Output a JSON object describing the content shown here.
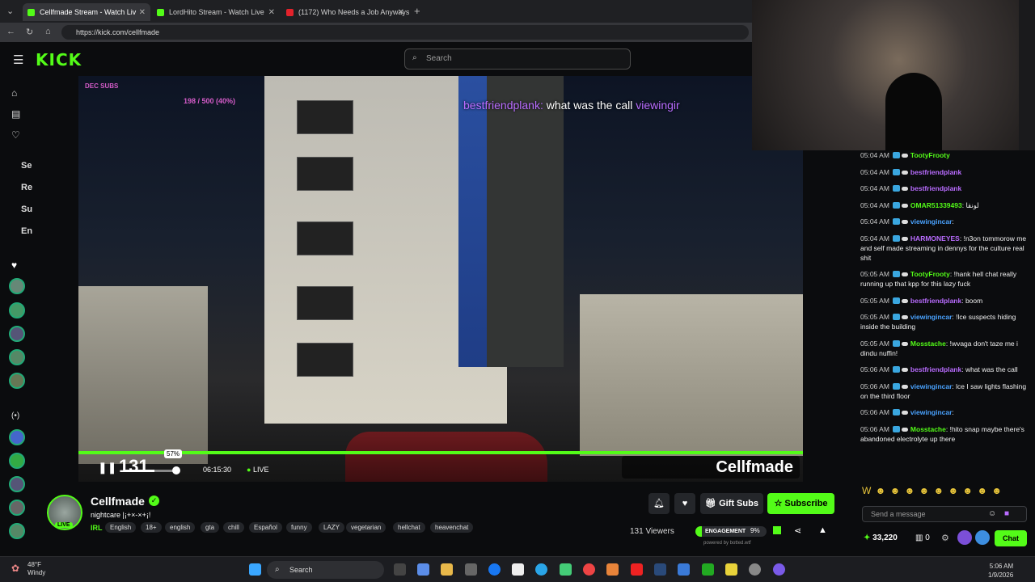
{
  "browser": {
    "tabs": [
      {
        "title": "Cellfmade Stream - Watch Liv",
        "active": true
      },
      {
        "title": "LordHito Stream - Watch Live",
        "active": false
      },
      {
        "title": "(1172) Who Needs a Job Anyways",
        "active": false
      }
    ],
    "new_tab": "+",
    "url": "https://kick.com/cellfmade"
  },
  "header": {
    "logo": "KICK",
    "search_placeholder": "Search"
  },
  "sidebar": {
    "abbr": [
      "Se",
      "Re",
      "Su",
      "En"
    ]
  },
  "video": {
    "dec_subs": "DEC SUBS",
    "sub_goal": "198 / 500 (40%)",
    "overlay_chat_user": "bestfriendplank:",
    "overlay_chat_text": " what was the call ",
    "overlay_chat_next": "viewingir",
    "brand": "Cellfmade",
    "viewer_overlay": "131",
    "volume_tooltip": "57%",
    "volume_level": 0.57,
    "time": "06:15:30",
    "live_label": "LIVE"
  },
  "channel": {
    "name": "Cellfmade",
    "title": "nightcare |¡+×-×+¡!",
    "category": "IRL",
    "live_badge": "LIVE",
    "tags": [
      "English",
      "18+",
      "english",
      "gta",
      "chill",
      "Español",
      "funny",
      "LAZY",
      "vegetarian",
      "hellchat",
      "heavenchat"
    ],
    "gift_label": "Gift Subs",
    "subscribe_label": "Subscribe",
    "viewers": "131 Viewers",
    "engagement_label": "ENGAGEMENT",
    "engagement_pct": "9%",
    "engagement_level": 0.09,
    "powered_by": "powered by botted.wtf"
  },
  "chat": {
    "messages": [
      {
        "time": "05:04 AM",
        "user": "TootyFrooty",
        "color": "#53fc18",
        "text": ""
      },
      {
        "time": "05:04 AM",
        "user": "bestfriendplank",
        "color": "#b96cff",
        "text": ""
      },
      {
        "time": "05:04 AM",
        "user": "bestfriendplank",
        "color": "#b96cff",
        "text": ""
      },
      {
        "time": "05:04 AM",
        "user": "OMAR51339493",
        "color": "#53fc18",
        "text": ": لونقا"
      },
      {
        "time": "05:04 AM",
        "user": "viewingincar",
        "color": "#4aa3ff",
        "text": ":"
      },
      {
        "time": "05:04 AM",
        "user": "HARMONEYES",
        "color": "#b96cff",
        "text": ": !n3on tommorow me and self made streaming in dennys for the culture real shit"
      },
      {
        "time": "05:05 AM",
        "user": "TootyFrooty",
        "color": "#53fc18",
        "text": ": !hank hell chat really running up that kpp for this lazy fuck"
      },
      {
        "time": "05:05 AM",
        "user": "bestfriendplank",
        "color": "#b96cff",
        "text": ": boom"
      },
      {
        "time": "05:05 AM",
        "user": "viewingincar",
        "color": "#4aa3ff",
        "text": ": !lce suspects hiding inside the building"
      },
      {
        "time": "05:05 AM",
        "user": "Mosstache",
        "color": "#53fc18",
        "text": ": !wvaga don't taze me i dindu nuffin!"
      },
      {
        "time": "05:06 AM",
        "user": "bestfriendplank",
        "color": "#b96cff",
        "text": ": what was the call"
      },
      {
        "time": "05:06 AM",
        "user": "viewingincar",
        "color": "#4aa3ff",
        "text": ": lce I saw lights flashing on the third floor"
      },
      {
        "time": "05:06 AM",
        "user": "viewingincar",
        "color": "#4aa3ff",
        "text": ":"
      },
      {
        "time": "05:06 AM",
        "user": "Mosstache",
        "color": "#53fc18",
        "text": ": !hito snap maybe there's abandoned electrolyte up there"
      }
    ],
    "input_placeholder": "Send a message",
    "points": "33,220",
    "count": "0",
    "chat_button": "Chat"
  },
  "taskbar": {
    "temp": "48°F",
    "weather": "Windy",
    "search": "Search",
    "time": "5:06 AM",
    "date": "1/9/2026"
  },
  "colors": {
    "accent": "#53fc18",
    "bg": "#0b0c0e"
  }
}
